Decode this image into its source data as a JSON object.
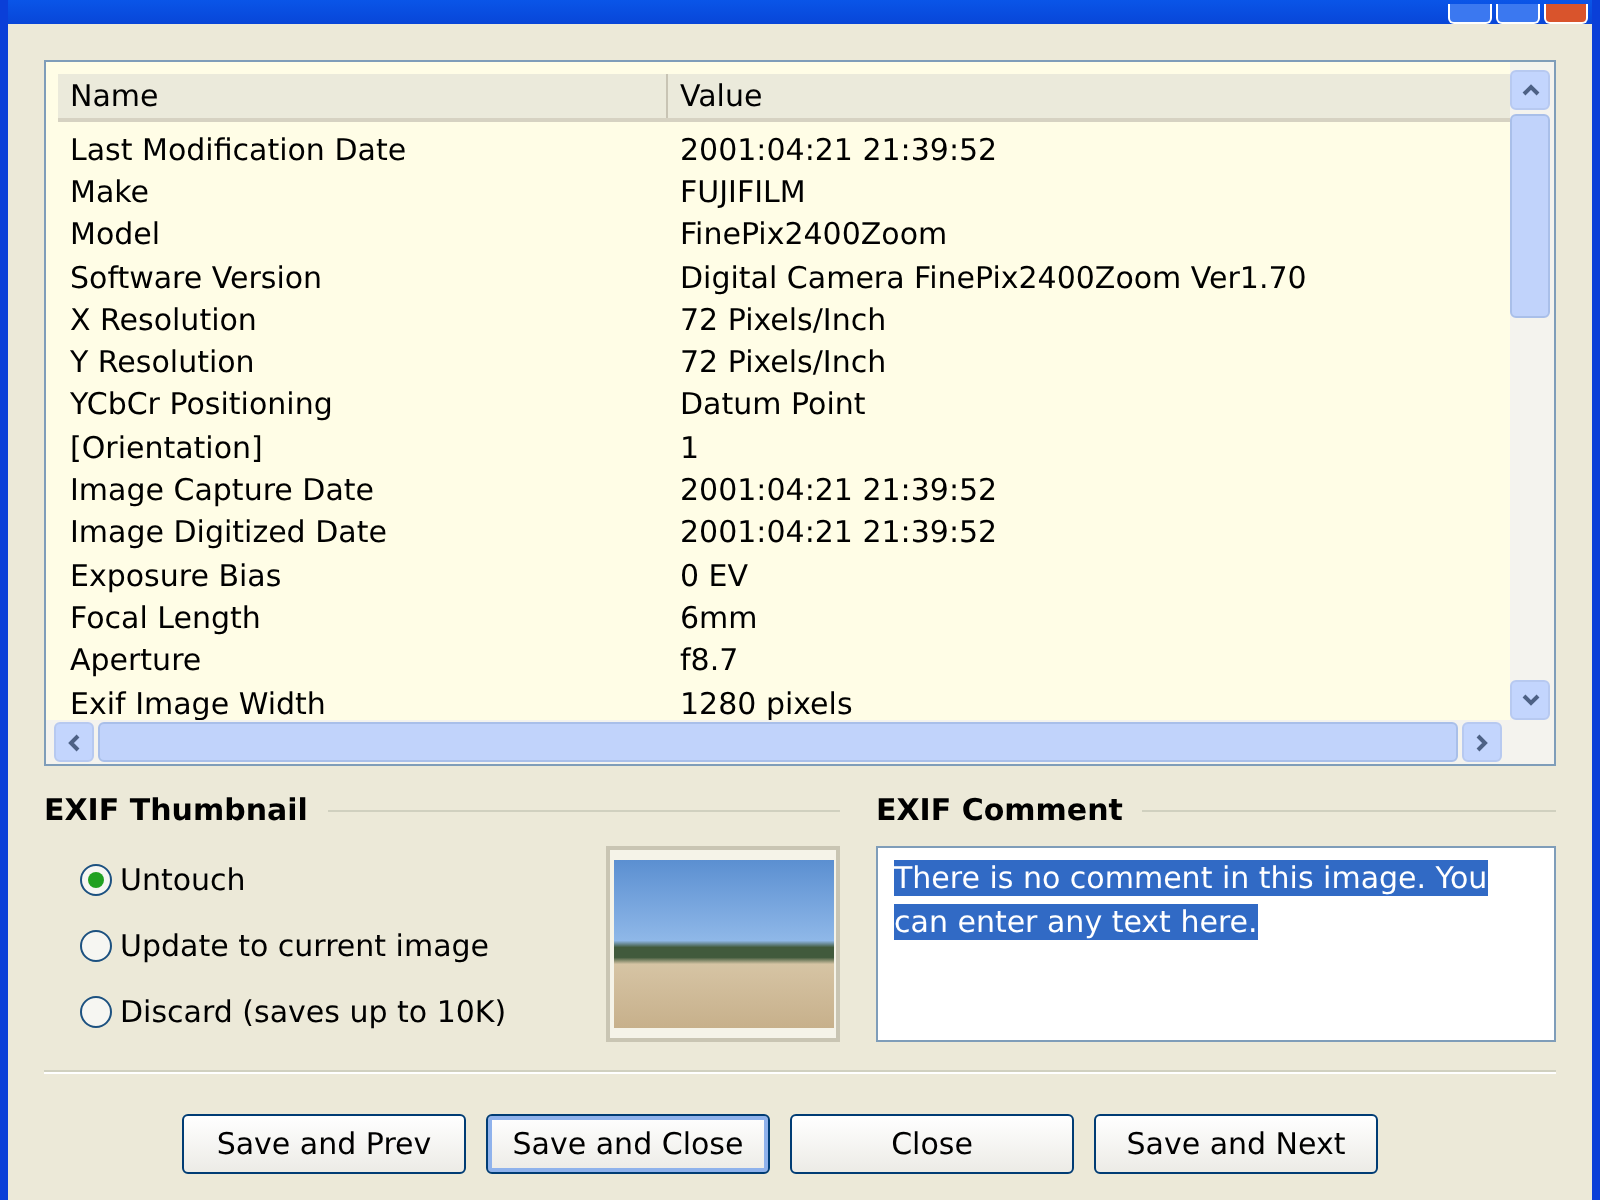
{
  "properties": {
    "columns": [
      "Name",
      "Value"
    ],
    "rows": [
      {
        "name": "Last Modification Date",
        "value": "2001:04:21 21:39:52"
      },
      {
        "name": "Make",
        "value": "FUJIFILM"
      },
      {
        "name": "Model",
        "value": "FinePix2400Zoom"
      },
      {
        "name": "Software Version",
        "value": "Digital Camera FinePix2400Zoom Ver1.70"
      },
      {
        "name": "X Resolution",
        "value": "72 Pixels/Inch"
      },
      {
        "name": "Y Resolution",
        "value": "72 Pixels/Inch"
      },
      {
        "name": "YCbCr Positioning",
        "value": "Datum Point"
      },
      {
        "name": "[Orientation]",
        "value": "1"
      },
      {
        "name": "Image Capture Date",
        "value": "2001:04:21 21:39:52"
      },
      {
        "name": "Image Digitized Date",
        "value": "2001:04:21 21:39:52"
      },
      {
        "name": "Exposure Bias",
        "value": "0 EV"
      },
      {
        "name": "Focal Length",
        "value": "6mm"
      },
      {
        "name": "Aperture",
        "value": "f8.7"
      },
      {
        "name": "Exif Image Width",
        "value": "1280 pixels"
      }
    ]
  },
  "thumbnail": {
    "heading": "EXIF Thumbnail",
    "options": [
      {
        "label": "Untouch",
        "selected": true
      },
      {
        "label": "Update to current image",
        "selected": false
      },
      {
        "label": "Discard (saves up to 10K)",
        "selected": false
      }
    ]
  },
  "comment": {
    "heading": "EXIF Comment",
    "value": "There is no comment in this image. You can enter any text here.",
    "selected": true
  },
  "buttons": [
    {
      "label": "Save and Prev",
      "focused": false
    },
    {
      "label": "Save and Close",
      "focused": true
    },
    {
      "label": "Close",
      "focused": false
    },
    {
      "label": "Save and Next",
      "focused": false
    }
  ]
}
